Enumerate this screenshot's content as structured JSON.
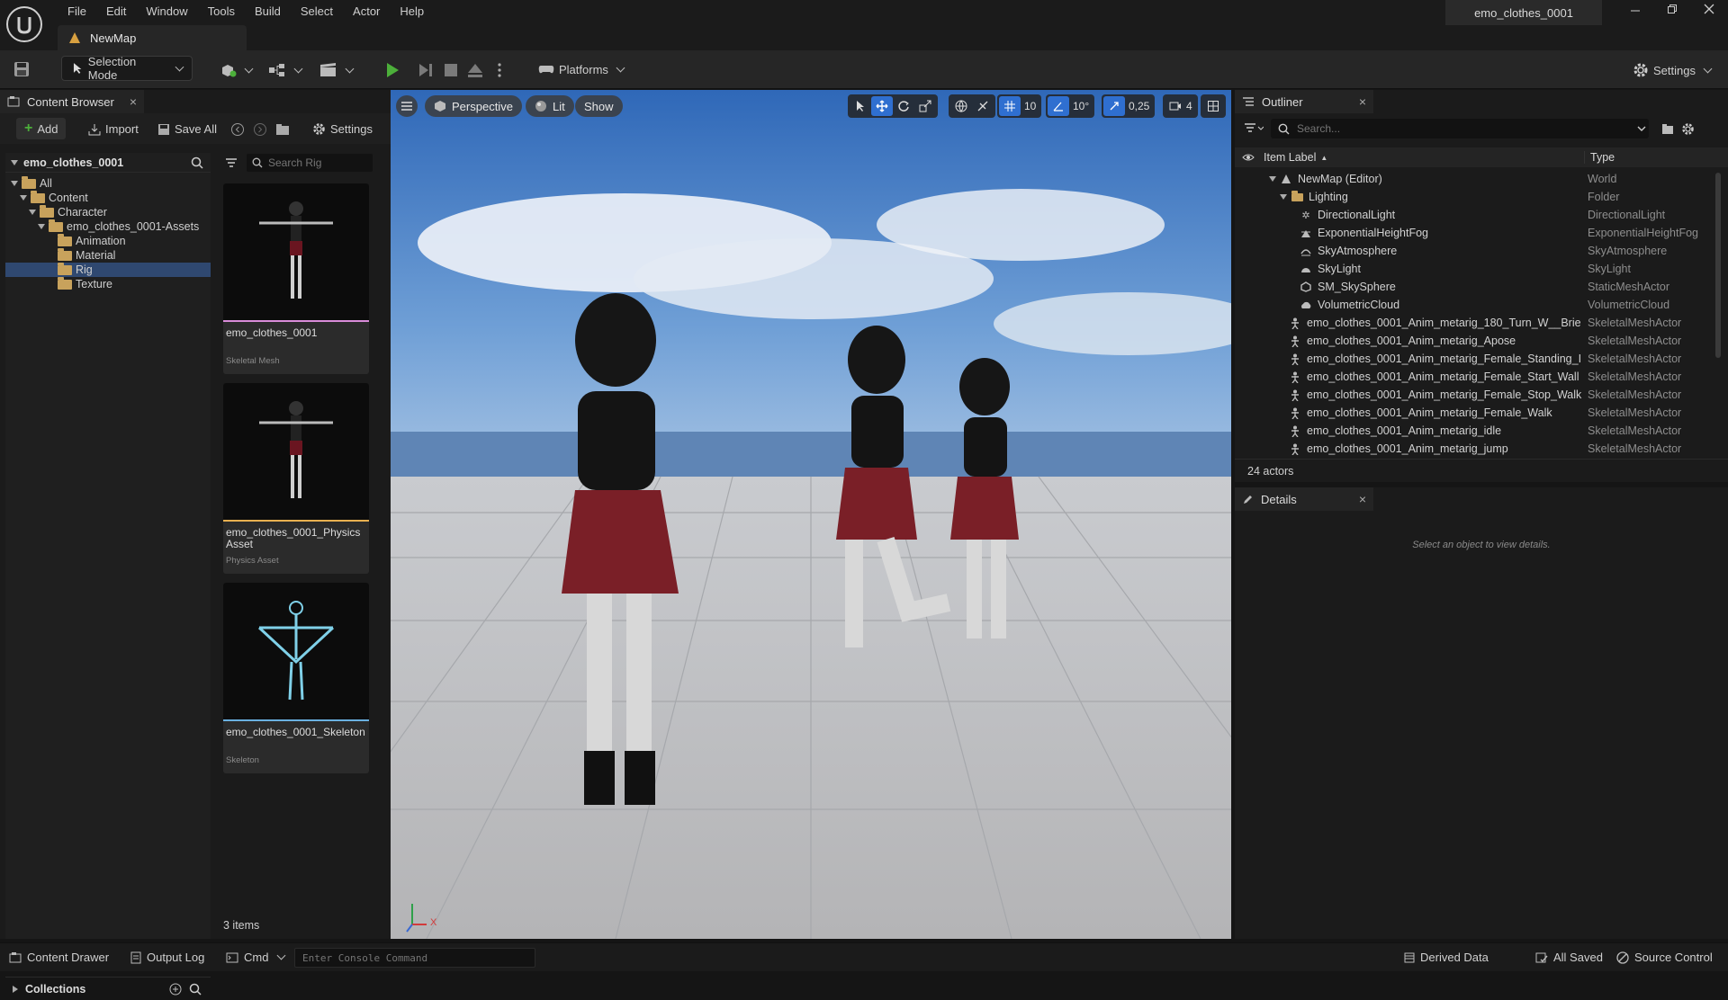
{
  "window": {
    "menu": [
      "File",
      "Edit",
      "Window",
      "Tools",
      "Build",
      "Select",
      "Actor",
      "Help"
    ],
    "map_tab": "NewMap",
    "project_name": "emo_clothes_0001"
  },
  "toolbar": {
    "selection_mode": "Selection Mode",
    "platforms": "Platforms",
    "settings": "Settings"
  },
  "content_browser": {
    "tab": "Content Browser",
    "add": "Add",
    "import": "Import",
    "save_all": "Save All",
    "settings": "Settings",
    "root": "emo_clothes_0001",
    "tree": [
      {
        "label": "All",
        "depth": 0,
        "expanded": true,
        "selected": false
      },
      {
        "label": "Content",
        "depth": 1,
        "expanded": true,
        "selected": false
      },
      {
        "label": "Character",
        "depth": 2,
        "expanded": true,
        "selected": false
      },
      {
        "label": "emo_clothes_0001-Assets",
        "depth": 3,
        "expanded": true,
        "selected": false
      },
      {
        "label": "Animation",
        "depth": 4,
        "expanded": false,
        "selected": false
      },
      {
        "label": "Material",
        "depth": 4,
        "expanded": false,
        "selected": false
      },
      {
        "label": "Rig",
        "depth": 4,
        "expanded": false,
        "selected": true
      },
      {
        "label": "Texture",
        "depth": 4,
        "expanded": false,
        "selected": false
      }
    ],
    "search_placeholder": "Search Rig",
    "assets": [
      {
        "name": "emo_clothes_0001",
        "type": "Skeletal Mesh",
        "accent": "#d98cd9"
      },
      {
        "name": "emo_clothes_0001_Physics Asset",
        "type": "Physics Asset",
        "accent": "#e8b050"
      },
      {
        "name": "emo_clothes_0001_Skeleton",
        "type": "Skeleton",
        "accent": "#6ab0e0"
      }
    ],
    "item_count": "3 items",
    "collections": "Collections"
  },
  "viewport": {
    "perspective": "Perspective",
    "lit": "Lit",
    "show": "Show",
    "grid_snap": "10",
    "rot_snap": "10°",
    "scale_snap": "0,25",
    "cam_speed": "4",
    "axis_x": "X"
  },
  "outliner": {
    "tab": "Outliner",
    "search_placeholder": "Search...",
    "col_label": "Item Label",
    "col_type": "Type",
    "rows": [
      {
        "label": "NewMap (Editor)",
        "type": "World",
        "indent": 0,
        "icon": "map-icon",
        "arrow": true
      },
      {
        "label": "Lighting",
        "type": "Folder",
        "indent": 1,
        "icon": "folder-icon",
        "arrow": true
      },
      {
        "label": "DirectionalLight",
        "type": "DirectionalLight",
        "indent": 2,
        "icon": "sun-icon",
        "arrow": false
      },
      {
        "label": "ExponentialHeightFog",
        "type": "ExponentialHeightFog",
        "indent": 2,
        "icon": "fog-icon",
        "arrow": false
      },
      {
        "label": "SkyAtmosphere",
        "type": "SkyAtmosphere",
        "indent": 2,
        "icon": "atmosphere-icon",
        "arrow": false
      },
      {
        "label": "SkyLight",
        "type": "SkyLight",
        "indent": 2,
        "icon": "skylight-icon",
        "arrow": false
      },
      {
        "label": "SM_SkySphere",
        "type": "StaticMeshActor",
        "indent": 2,
        "icon": "static-mesh-icon",
        "arrow": false
      },
      {
        "label": "VolumetricCloud",
        "type": "VolumetricCloud",
        "indent": 2,
        "icon": "cloud-icon",
        "arrow": false
      },
      {
        "label": "emo_clothes_0001_Anim_metarig_180_Turn_W__Brie",
        "type": "SkeletalMeshActor",
        "indent": 1,
        "icon": "skeletal-mesh-icon",
        "arrow": false
      },
      {
        "label": "emo_clothes_0001_Anim_metarig_Apose",
        "type": "SkeletalMeshActor",
        "indent": 1,
        "icon": "skeletal-mesh-icon",
        "arrow": false
      },
      {
        "label": "emo_clothes_0001_Anim_metarig_Female_Standing_I",
        "type": "SkeletalMeshActor",
        "indent": 1,
        "icon": "skeletal-mesh-icon",
        "arrow": false
      },
      {
        "label": "emo_clothes_0001_Anim_metarig_Female_Start_Wall",
        "type": "SkeletalMeshActor",
        "indent": 1,
        "icon": "skeletal-mesh-icon",
        "arrow": false
      },
      {
        "label": "emo_clothes_0001_Anim_metarig_Female_Stop_Walk",
        "type": "SkeletalMeshActor",
        "indent": 1,
        "icon": "skeletal-mesh-icon",
        "arrow": false
      },
      {
        "label": "emo_clothes_0001_Anim_metarig_Female_Walk",
        "type": "SkeletalMeshActor",
        "indent": 1,
        "icon": "skeletal-mesh-icon",
        "arrow": false
      },
      {
        "label": "emo_clothes_0001_Anim_metarig_idle",
        "type": "SkeletalMeshActor",
        "indent": 1,
        "icon": "skeletal-mesh-icon",
        "arrow": false
      },
      {
        "label": "emo_clothes_0001_Anim_metarig_jump",
        "type": "SkeletalMeshActor",
        "indent": 1,
        "icon": "skeletal-mesh-icon",
        "arrow": false
      }
    ],
    "actor_count": "24 actors"
  },
  "details": {
    "tab": "Details",
    "empty_message": "Select an object to view details."
  },
  "status_bar": {
    "content_drawer": "Content Drawer",
    "output_log": "Output Log",
    "cmd": "Cmd",
    "console_placeholder": "Enter Console Command",
    "derived_data": "Derived Data",
    "all_saved": "All Saved",
    "source_control": "Source Control"
  },
  "colors": {
    "accent_green": "#4caf3a",
    "selection_blue": "#2f4870",
    "folder": "#c8a25c"
  }
}
